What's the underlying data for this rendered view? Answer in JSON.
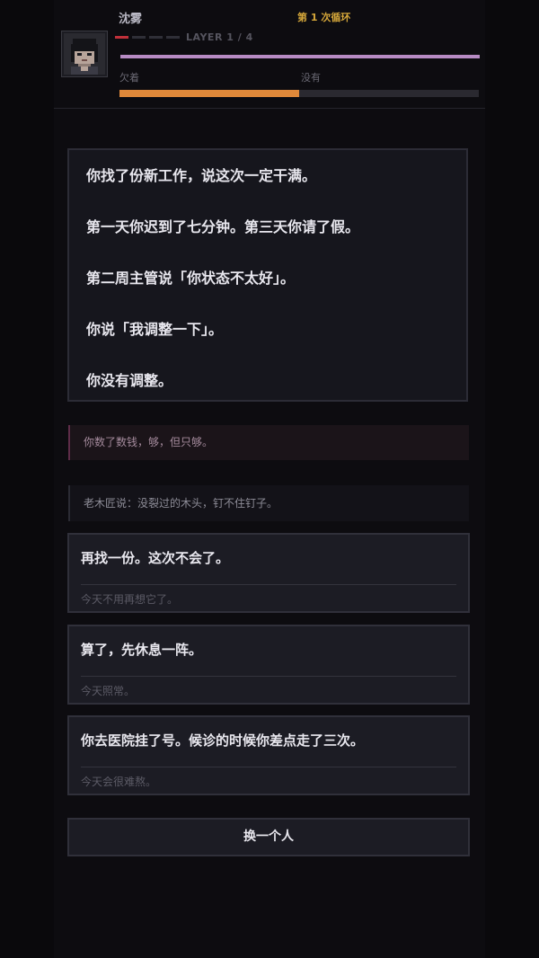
{
  "character": {
    "name": "沈雾",
    "layer_label": "LAYER 1 / 4",
    "layer_pips": {
      "total": 4,
      "active": 1
    }
  },
  "loop": {
    "label": "第 1 次循环"
  },
  "meters": {
    "top_bar_fill": 1.0,
    "left_label": "欠着",
    "right_label": "没有",
    "bottom_bar_fill": 0.5
  },
  "colors": {
    "loop_accent": "#d5a73a",
    "pip_active": "#c0303a",
    "bar_purple": "#b78bc4",
    "bar_orange": "#e0893a"
  },
  "story": {
    "lines": [
      "你找了份新工作，说这次一定干满。",
      "第一天你迟到了七分钟。第三天你请了假。",
      "第二周主管说「你状态不太好」。",
      "你说「我调整一下」。",
      "你没有调整。"
    ]
  },
  "notes": {
    "inner_thought": "你数了数钱，够，但只够。",
    "quote": "老木匠说：没裂过的木头，钉不住钉子。"
  },
  "choices": [
    {
      "text": "再找一份。这次不会了。",
      "hint": "今天不用再想它了。"
    },
    {
      "text": "算了，先休息一阵。",
      "hint": "今天照常。"
    },
    {
      "text": "你去医院挂了号。候诊的时候你差点走了三次。",
      "hint": "今天会很难熬。"
    }
  ],
  "actions": {
    "switch_person": "换一个人"
  }
}
